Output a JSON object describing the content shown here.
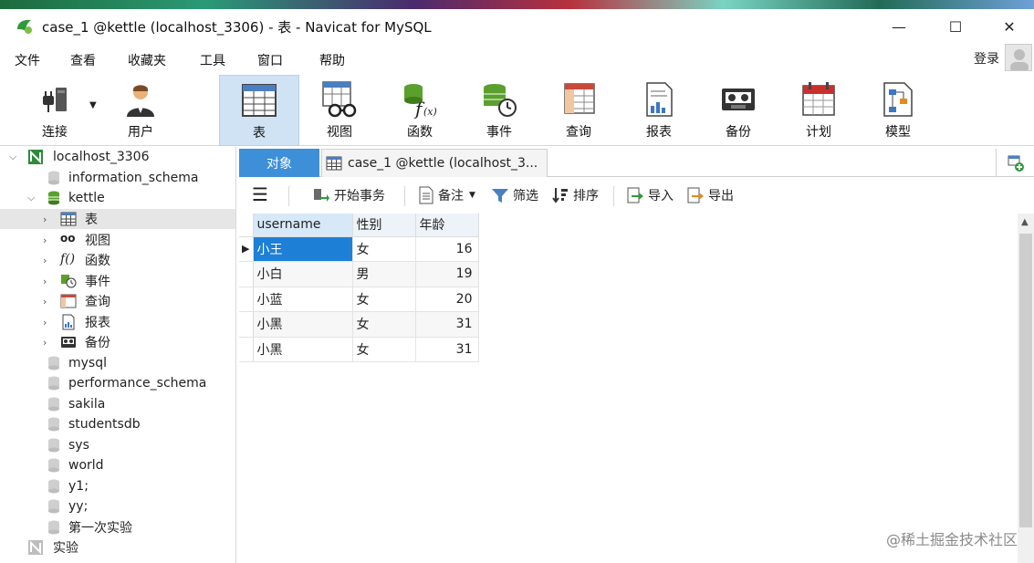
{
  "window": {
    "title": "case_1 @kettle (localhost_3306) - 表 - Navicat for MySQL",
    "controls": {
      "minimize": "—",
      "maximize": "☐",
      "close": "✕"
    }
  },
  "menu": {
    "items": [
      "文件",
      "查看",
      "收藏夹",
      "工具",
      "窗口",
      "帮助"
    ],
    "login": "登录"
  },
  "toolbar": {
    "buttons": [
      {
        "label": "连接",
        "icon": "plug-icon"
      },
      {
        "label": "用户",
        "icon": "user-icon"
      },
      {
        "label": "表",
        "icon": "table-icon",
        "active": true
      },
      {
        "label": "视图",
        "icon": "view-glasses-icon"
      },
      {
        "label": "函数",
        "icon": "function-icon"
      },
      {
        "label": "事件",
        "icon": "event-clock-icon"
      },
      {
        "label": "查询",
        "icon": "query-icon"
      },
      {
        "label": "报表",
        "icon": "report-icon"
      },
      {
        "label": "备份",
        "icon": "backup-tape-icon"
      },
      {
        "label": "计划",
        "icon": "schedule-calendar-icon"
      },
      {
        "label": "模型",
        "icon": "model-icon"
      }
    ]
  },
  "sidebar": {
    "connection": "localhost_3306",
    "databases_top": [
      "information_schema"
    ],
    "kettle": {
      "name": "kettle",
      "children": [
        "表",
        "视图",
        "函数",
        "事件",
        "查询",
        "报表",
        "备份"
      ]
    },
    "databases_rest": [
      "mysql",
      "performance_schema",
      "sakila",
      "studentsdb",
      "sys",
      "world",
      "y1;",
      "yy;",
      "第一次实验"
    ],
    "other_connection": "实验"
  },
  "tabs": {
    "objects": "对象",
    "current": "case_1 @kettle (localhost_3..."
  },
  "subtoolbar": {
    "menu": "☰",
    "begin_transaction": "开始事务",
    "note": "备注",
    "filter": "筛选",
    "sort": "排序",
    "import": "导入",
    "export": "导出"
  },
  "grid": {
    "columns": [
      "username",
      "性别",
      "年龄"
    ],
    "rows": [
      [
        "小王",
        "女",
        "16"
      ],
      [
        "小白",
        "男",
        "19"
      ],
      [
        "小蓝",
        "女",
        "20"
      ],
      [
        "小黑",
        "女",
        "31"
      ],
      [
        "小黑",
        "女",
        "31"
      ]
    ]
  },
  "watermark": "@稀土掘金技术社区",
  "colors": {
    "accent": "#3d8fd8",
    "selection": "#1e7fd6",
    "active_tool": "#cfe3f5"
  }
}
